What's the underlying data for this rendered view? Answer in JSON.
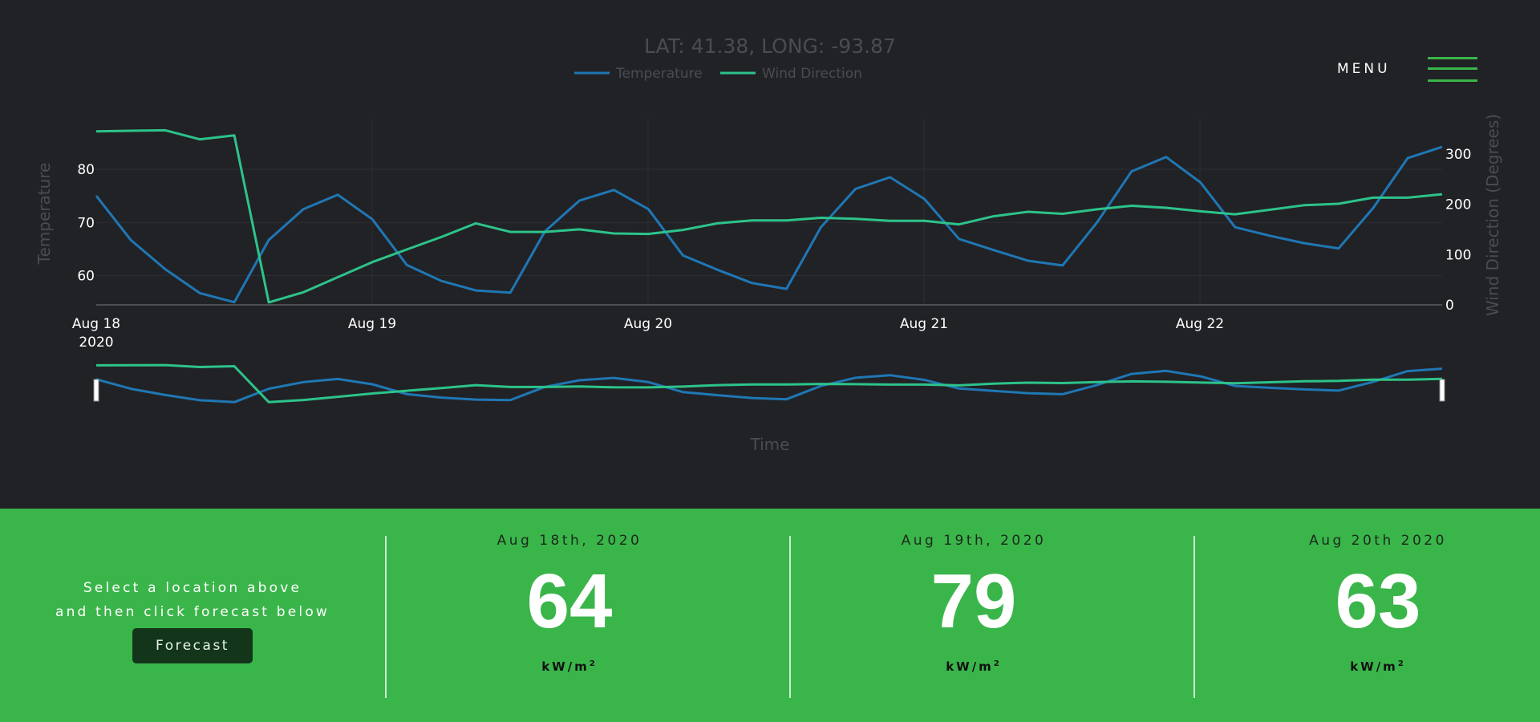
{
  "chart": {
    "title": "LAT: 41.38, LONG: -93.87",
    "xlabel": "Time",
    "ylabel_left": "Temperature",
    "ylabel_right": "Wind Direction (Degrees)"
  },
  "chart_data": {
    "type": "line",
    "title": "LAT: 41.38, LONG: -93.87",
    "xlabel": "Time",
    "ylabel": "Temperature",
    "ylabel_right": "Wind Direction (Degrees)",
    "x_tick_labels": [
      "Aug 18",
      "Aug 19",
      "Aug 20",
      "Aug 21",
      "Aug 22"
    ],
    "x_tick_year": "2020",
    "left_ticks": [
      60,
      70,
      80
    ],
    "right_ticks": [
      0,
      100,
      200,
      300
    ],
    "ylim_left": [
      54.5,
      89.5
    ],
    "ylim_right": [
      0,
      370
    ],
    "legend_position": "top-center",
    "series": [
      {
        "name": "Temperature",
        "axis": "left",
        "color": "#1f77b4",
        "values": [
          75,
          66.7,
          61.2,
          56.7,
          55,
          66.7,
          72.5,
          75.2,
          70.6,
          62,
          59,
          57.2,
          56.8,
          68.3,
          74.1,
          76.1,
          72.5,
          63.8,
          61.1,
          58.6,
          57.5,
          69.1,
          76.3,
          78.5,
          74.4,
          66.9,
          64.8,
          62.8,
          61.9,
          70,
          79.6,
          82.3,
          77.5,
          69.1,
          67.5,
          66.1,
          65.1,
          72.7,
          82.1,
          84.2
        ]
      },
      {
        "name": "Wind Direction",
        "axis": "right",
        "color": "#2dc38a",
        "values": [
          345,
          346,
          347,
          329,
          337,
          5,
          25,
          55,
          85,
          110,
          135,
          162,
          145,
          145,
          150,
          142,
          141,
          149,
          162,
          168,
          168,
          173,
          171,
          167,
          167,
          160,
          176,
          185,
          181,
          190,
          197,
          193,
          186,
          180,
          189,
          198,
          201,
          213,
          213,
          220
        ]
      }
    ]
  },
  "menu": {
    "label": "MENU"
  },
  "prompt": {
    "line1": "Select a location above",
    "line2": "and then click forecast below"
  },
  "forecast_button": {
    "label": "Forecast"
  },
  "cards": [
    {
      "date": "Aug 18th, 2020",
      "value": "64",
      "unit": "kW/m"
    },
    {
      "date": "Aug 19th, 2020",
      "value": "79",
      "unit": "kW/m"
    },
    {
      "date": "Aug 20th 2020",
      "value": "63",
      "unit": "kW/m"
    }
  ],
  "colors": {
    "background": "#212226",
    "accent": "#3ab54a",
    "temperature": "#1f77b4",
    "wind": "#2dc38a"
  }
}
